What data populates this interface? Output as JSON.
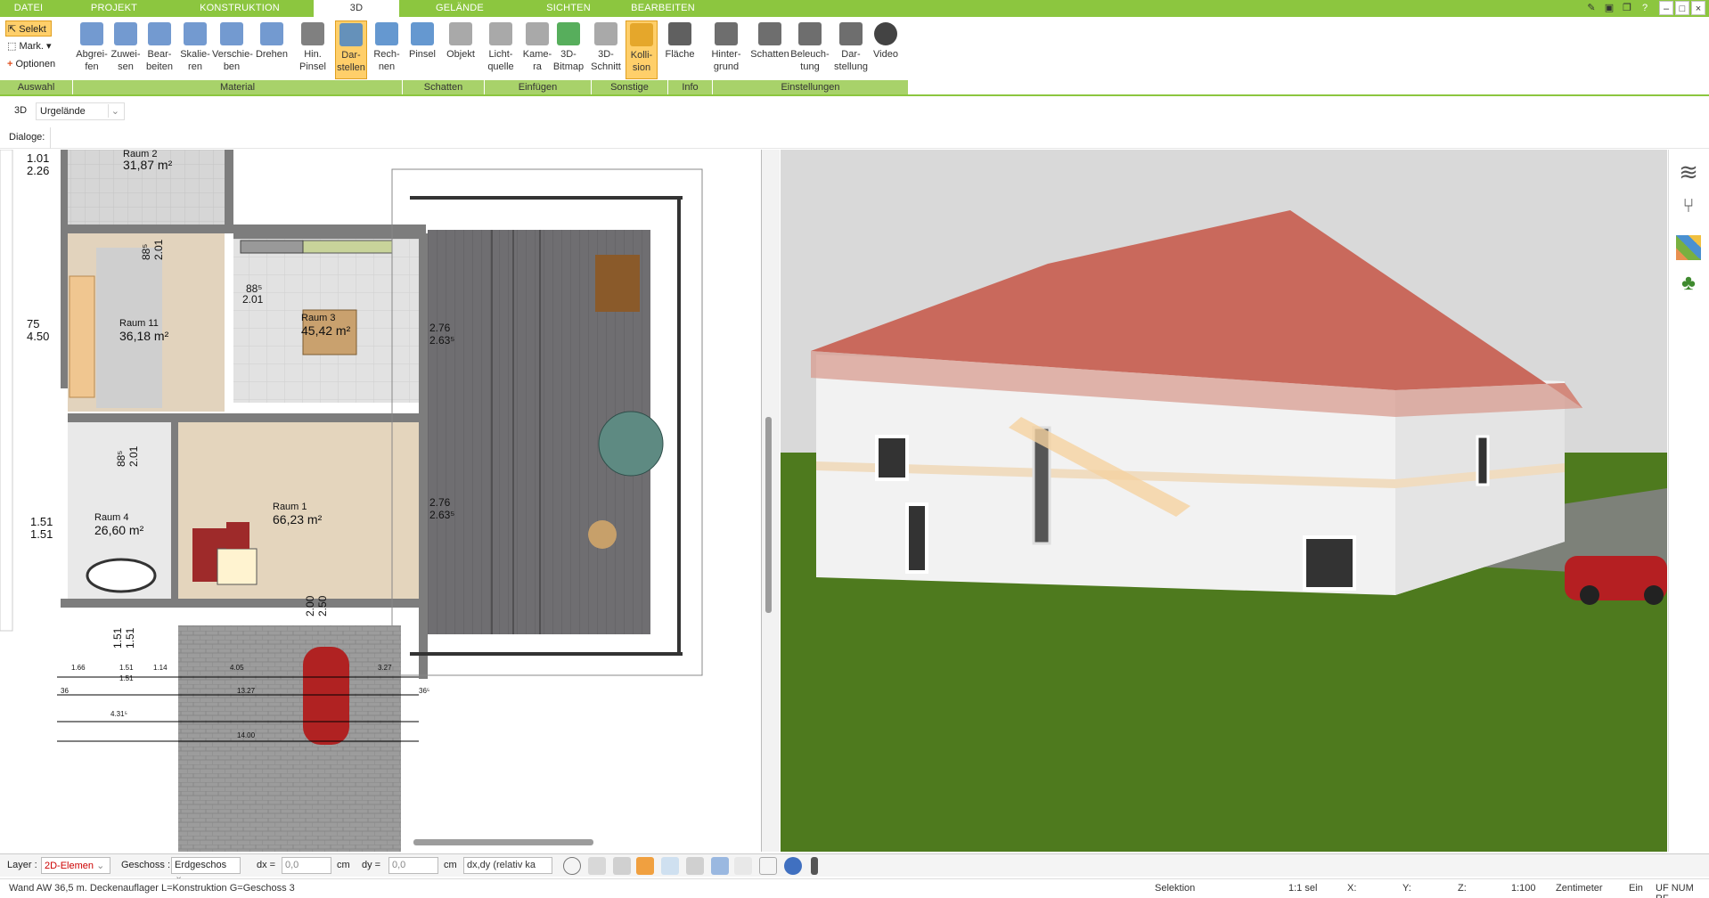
{
  "tabs": [
    {
      "label": "DATEI",
      "active": false
    },
    {
      "label": "PROJEKT",
      "active": false
    },
    {
      "label": "KONSTRUKTION",
      "active": false
    },
    {
      "label": "3D",
      "active": true
    },
    {
      "label": "GELÄNDE",
      "active": false
    },
    {
      "label": "SICHTEN",
      "active": false
    },
    {
      "label": "BEARBEITEN",
      "active": false
    }
  ],
  "ribbon": {
    "selection": {
      "select": "Selekt",
      "mark": "Mark.",
      "options": "Optionen"
    },
    "buttons": [
      {
        "l1": "Abgrei-",
        "l2": "fen"
      },
      {
        "l1": "Zuwei-",
        "l2": "sen"
      },
      {
        "l1": "Bear-",
        "l2": "beiten"
      },
      {
        "l1": "Skalie-",
        "l2": "ren"
      },
      {
        "l1": "Verschie-",
        "l2": "ben"
      },
      {
        "l1": "Drehen",
        "l2": ""
      },
      {
        "l1": "Hin.",
        "l2": "Pinsel"
      },
      {
        "l1": "Dar-",
        "l2": "stellen"
      },
      {
        "l1": "Rech-",
        "l2": "nen"
      },
      {
        "l1": "Pinsel",
        "l2": ""
      },
      {
        "l1": "Objekt",
        "l2": ""
      },
      {
        "l1": "Licht-",
        "l2": "quelle"
      },
      {
        "l1": "Kame-",
        "l2": "ra"
      },
      {
        "l1": "3D-",
        "l2": "Bitmap"
      },
      {
        "l1": "3D-",
        "l2": "Schnitt"
      },
      {
        "l1": "Kolli-",
        "l2": "sion"
      },
      {
        "l1": "Fläche",
        "l2": ""
      },
      {
        "l1": "Hinter-",
        "l2": "grund"
      },
      {
        "l1": "Schatten",
        "l2": ""
      },
      {
        "l1": "Beleuch-",
        "l2": "tung"
      },
      {
        "l1": "Dar-",
        "l2": "stellung"
      },
      {
        "l1": "Video",
        "l2": ""
      }
    ],
    "groups": [
      "Auswahl",
      "Material",
      "Schatten",
      "Einfügen",
      "Sonstige",
      "Info",
      "Einstellungen"
    ]
  },
  "view_bar": {
    "mode": "3D",
    "terrain": "Urgelände"
  },
  "dialogs_label": "Dialoge:",
  "plan": {
    "rooms": [
      {
        "name": "Raum 2",
        "area": "31,87 m²"
      },
      {
        "name": "Raum 11",
        "area": "36,18 m²"
      },
      {
        "name": "Raum 3",
        "area": "45,42 m²"
      },
      {
        "name": "Raum 4",
        "area": "26,60 m²"
      },
      {
        "name": "Raum 1",
        "area": "66,23 m²"
      }
    ],
    "dims": [
      "1.01",
      "2.26",
      "75",
      "4.50",
      "1.51",
      "1.51",
      "88⁵",
      "2.01",
      "88⁵",
      "2.01",
      "88⁵",
      "2.01",
      "2.76",
      "2.63⁵",
      "2.76",
      "2.63⁵",
      "2.00",
      "2.50",
      "1.51",
      "1.51"
    ],
    "small_dims": [
      "1.66",
      "1.51",
      "1.51",
      "1.14",
      "4.05",
      "13.27",
      "4.31⁵",
      "14.00",
      "3.27",
      "36",
      "36⁵"
    ]
  },
  "toolbar": {
    "layer_label": "Layer :",
    "layer_value": "2D-Elemen",
    "floor_label": "Geschoss :",
    "floor_value": "Erdgeschos",
    "dx_label": "dx =",
    "dx_value": "0,0",
    "dx_unit": "cm",
    "dy_label": "dy =",
    "dy_value": "0,0",
    "dy_unit": "cm",
    "mode_value": "dx,dy (relativ ka"
  },
  "status": {
    "info": "Wand AW 36,5 m. Deckenauflager L=Konstruktion G=Geschoss 3",
    "mode": "Selektion",
    "sel": "1:1 sel",
    "x": "X:",
    "y": "Y:",
    "z": "Z:",
    "scale": "1:100",
    "unit": "Zentimeter",
    "on": "Ein",
    "flags": "UF NUM RF"
  },
  "colors": {
    "accent": "#8cc63f",
    "group": "#a8d26a",
    "active_btn": "#ffcf6a",
    "roof": "#c9695c",
    "grass": "#4e7a1e",
    "sky": "#d9d9d9"
  }
}
